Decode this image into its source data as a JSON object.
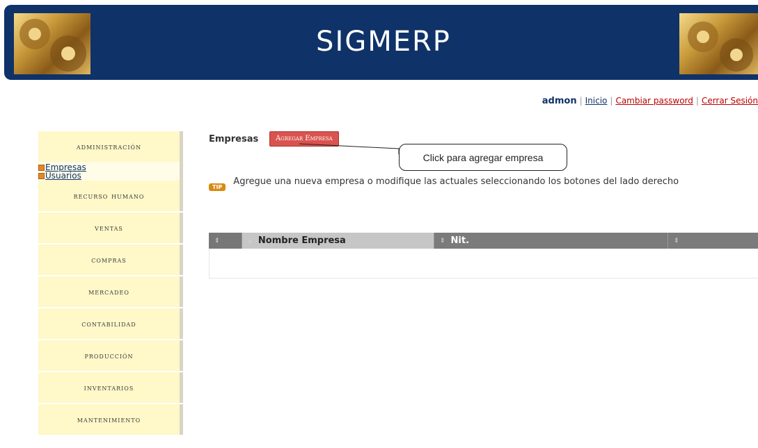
{
  "header": {
    "title": "SIGMERP"
  },
  "topbar": {
    "user": "admon",
    "links": [
      "Inicio",
      "Cambiar password",
      "Cerrar Sesión"
    ]
  },
  "sidebar": {
    "sections": [
      {
        "label": "Administración",
        "sub_items": [
          "Empresas",
          "Usuarios"
        ]
      },
      {
        "label": "Recurso Humano"
      },
      {
        "label": "Ventas"
      },
      {
        "label": "Compras"
      },
      {
        "label": "Mercadeo"
      },
      {
        "label": "Contabilidad"
      },
      {
        "label": "Producción"
      },
      {
        "label": "Inventarios"
      },
      {
        "label": "mantenimiento"
      }
    ]
  },
  "main": {
    "title": "Empresas",
    "add_button": "Agregar Empresa",
    "callout": "Click para agregar empresa",
    "tip": {
      "badge": "TIP",
      "text": "Agregue una nueva empresa o modifique las actuales seleccionando los botones del lado derecho"
    },
    "grid": {
      "columns": [
        "",
        "Nombre Empresa",
        "Nit.",
        ""
      ],
      "rows": []
    }
  },
  "colors": {
    "header_bg": "#0f3268",
    "sidebar_bg": "#fff8c8",
    "button_red": "#d9534f",
    "tip_orange": "#d98a12"
  }
}
